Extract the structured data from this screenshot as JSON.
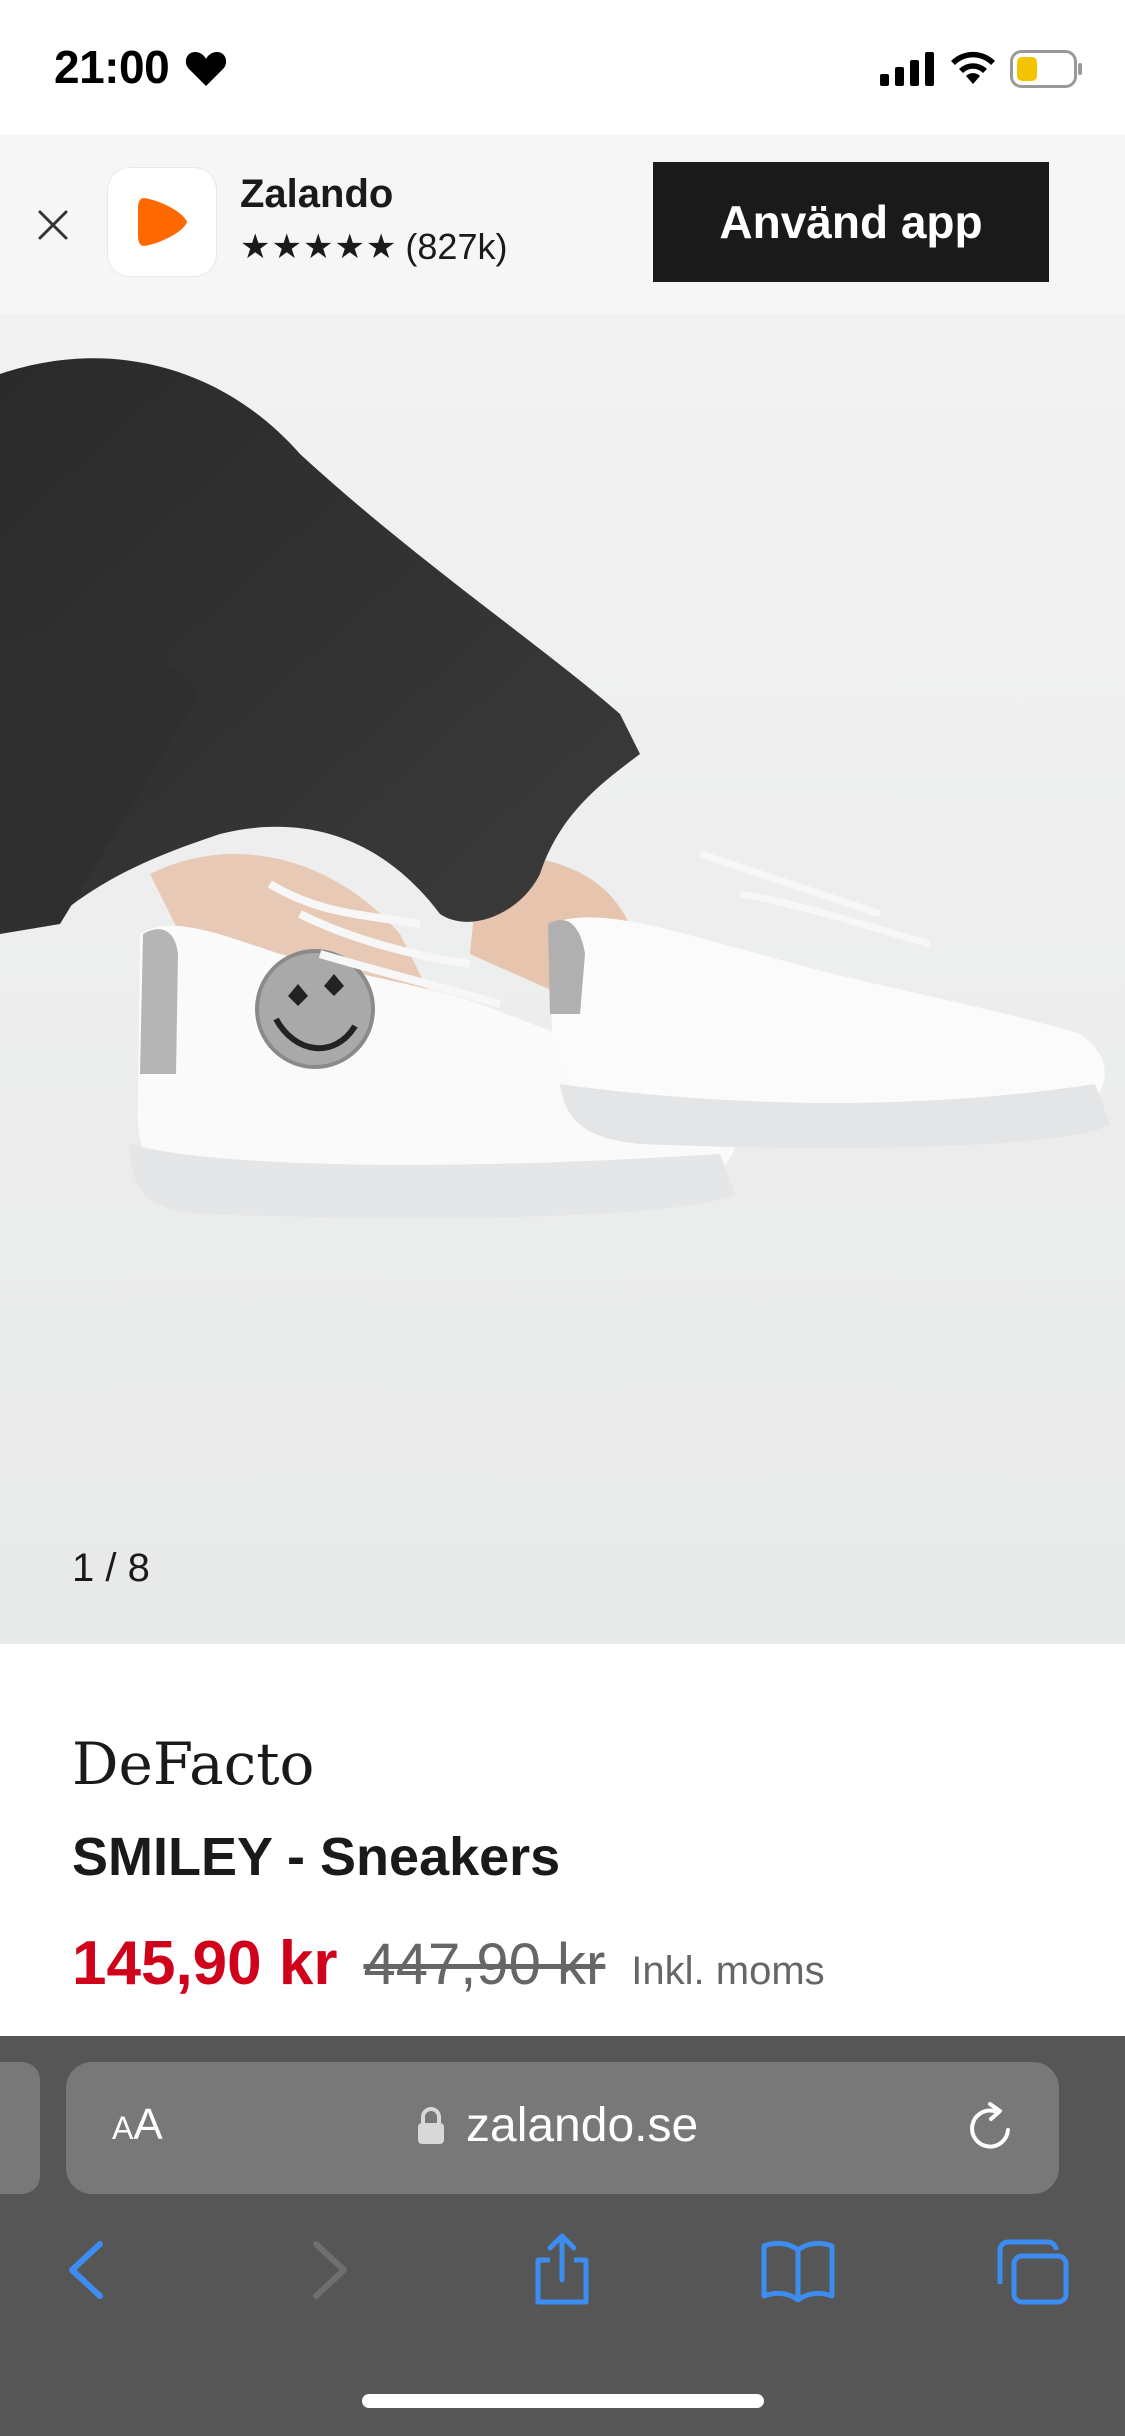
{
  "status_bar": {
    "time": "21:00",
    "icons": [
      "heart-icon",
      "signal-icon",
      "wifi-icon",
      "battery-icon"
    ],
    "battery_color": "#f5c400"
  },
  "app_banner": {
    "app_name": "Zalando",
    "stars": "★★★★★",
    "rating_count": "(827k)",
    "open_button_label": "Använd app",
    "logo_color": "#ff6900"
  },
  "product": {
    "image_counter": "1 / 8",
    "brand": "DeFacto",
    "title": "SMILEY - Sneakers",
    "price_sale": "145,90 kr",
    "price_original": "447,90 kr",
    "price_note": "Inkl. moms",
    "sale_color": "#d0011b"
  },
  "browser": {
    "text_size_small": "A",
    "text_size_large": "A",
    "url": "zalando.se",
    "accent_color": "#3d8cf0"
  }
}
